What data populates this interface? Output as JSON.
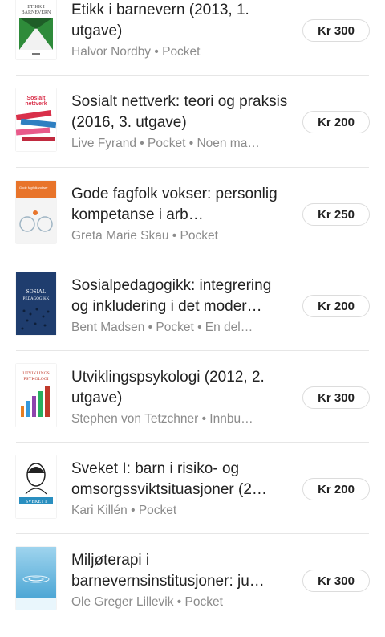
{
  "items": [
    {
      "title": "Etikk i barnevern (2013, 1. utgave)",
      "meta": "Halvor Nordby • Pocket",
      "price": "Kr 300",
      "cover_text": "ETIKK I BARNEVERN",
      "cover_accent": "#2e8b3a"
    },
    {
      "title": "Sosialt nettverk: teori og praksis (2016, 3. utgave)",
      "meta": "Live Fyrand • Pocket • Noen ma…",
      "price": "Kr 200",
      "cover_text": "Sosialt nettverk",
      "cover_accent": "#d9304a"
    },
    {
      "title": "Gode fagfolk vokser: personlig kompetanse i arb…",
      "meta": "Greta Marie Skau • Pocket",
      "price": "Kr 250",
      "cover_text": "Gode fagfolk vokser",
      "cover_accent": "#e8742a"
    },
    {
      "title": "Sosialpedagogikk: integrering og inkludering i det moder…",
      "meta": "Bent Madsen • Pocket • En del…",
      "price": "Kr 200",
      "cover_text": "SOSIAL PEDAGOGIKK",
      "cover_accent": "#1f3d6e"
    },
    {
      "title": "Utviklingspsykologi (2012, 2. utgave)",
      "meta": "Stephen von Tetzchner • Innbu…",
      "price": "Kr 300",
      "cover_text": "UTVIKLINGS PSYKOLOGI",
      "cover_accent": "#c0392b"
    },
    {
      "title": "Sveket I: barn i risiko- og omsorgssviktsituasjoner (2…",
      "meta": "Kari Killén • Pocket",
      "price": "Kr 200",
      "cover_text": "SVEKET I",
      "cover_accent": "#2a8fc0"
    },
    {
      "title": "Miljøterapi i barnevernsinstitusjoner: ju…",
      "meta": "Ole Greger Lillevik • Pocket",
      "price": "Kr 300",
      "cover_text": "",
      "cover_accent": "#5fb3d9"
    }
  ]
}
